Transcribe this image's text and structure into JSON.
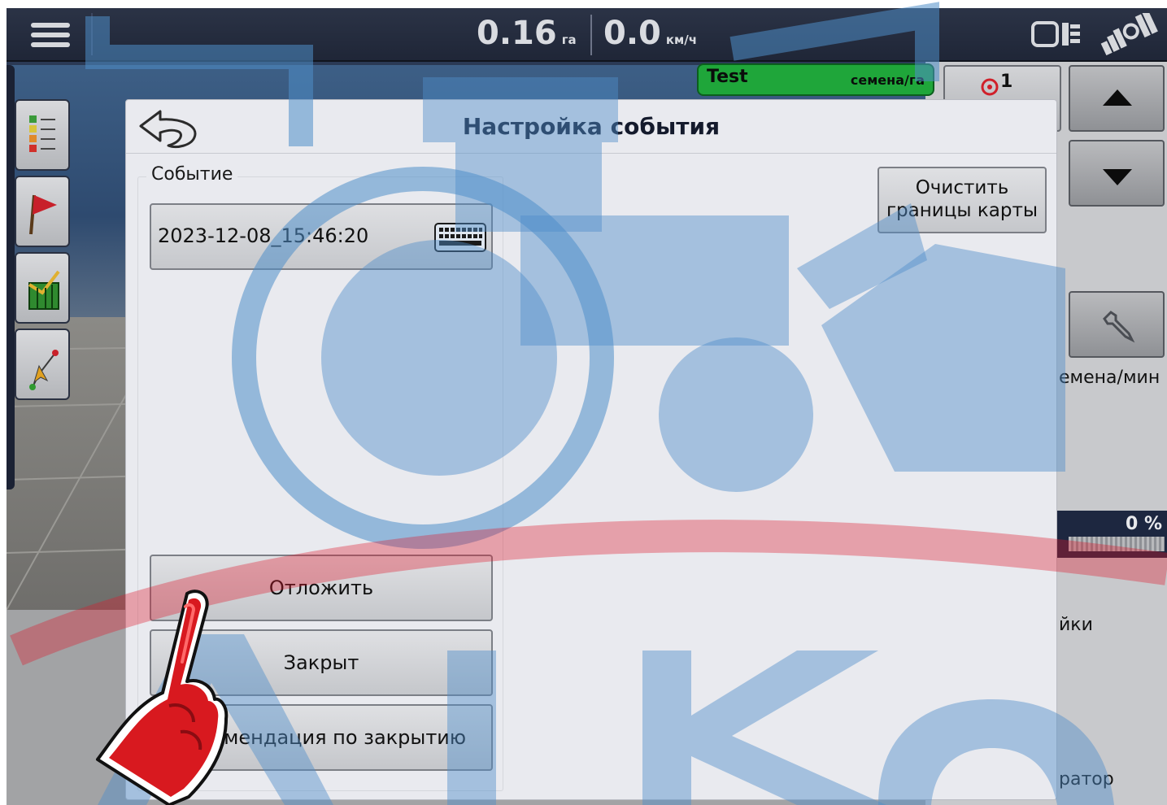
{
  "topbar": {
    "area_value": "0.16",
    "area_unit": "га",
    "speed_value": "0.0",
    "speed_unit": "км/ч"
  },
  "icons": {
    "menu": "hamburger-menu-icon",
    "display": "display-toggle-icon",
    "gps": "gps-signal-icon",
    "keyboard": "keyboard-icon",
    "back": "back-arrow-icon",
    "wrench": "wrench-icon"
  },
  "product": {
    "name": "Test",
    "rate_unit": "семена/га"
  },
  "right_panel": {
    "target_count": "1",
    "rate_unit_partial": "емена/мин",
    "percent": "0 %",
    "settings_partial": "йки",
    "operator_partial": "ратор"
  },
  "dialog": {
    "title": "Настройка события",
    "event_legend": "Событие",
    "event_value": "2023-12-08_15:46:20",
    "clear_map_label_line1": "Очистить",
    "clear_map_label_line2": "границы карты",
    "postpone_label": "Отложить",
    "close_label": "Закрыт",
    "recommendation_label": "Рекомендация по закрытию"
  },
  "colors": {
    "product_badge": "#1fa63a",
    "watermark_blue": "#4f8ec9",
    "watermark_red": "#e0182a"
  }
}
